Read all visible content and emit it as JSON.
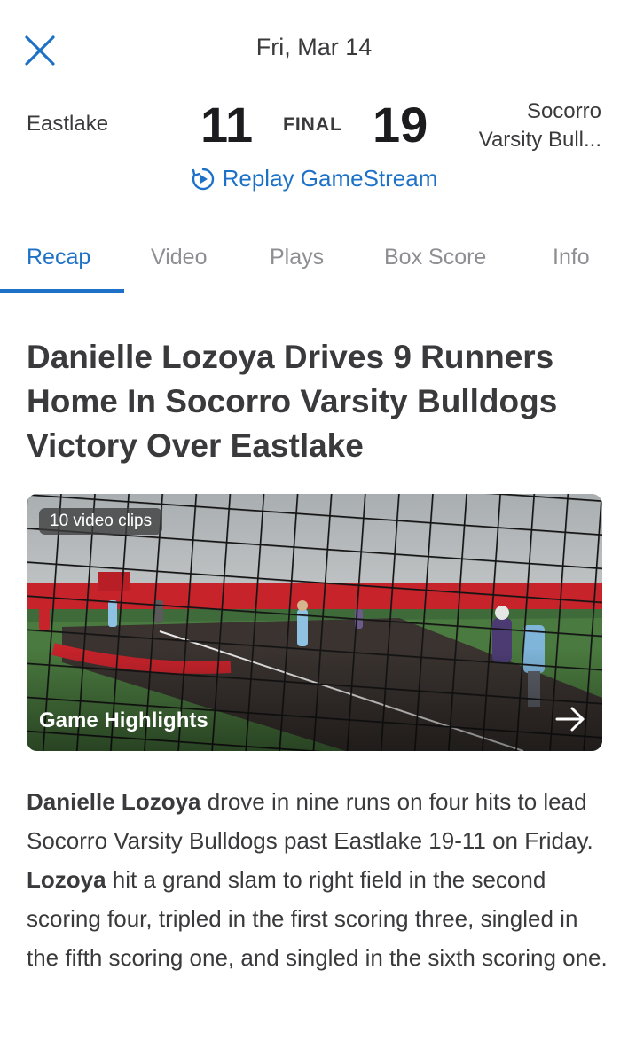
{
  "header": {
    "date": "Fri, Mar 14",
    "close_icon": "close-icon"
  },
  "score": {
    "home_team": "Eastlake",
    "home_score": "11",
    "status": "FINAL",
    "away_score": "19",
    "away_team_line1": "Socorro",
    "away_team_line2": "Varsity Bull..."
  },
  "replay": {
    "label": "Replay GameStream",
    "icon": "replay-icon"
  },
  "tabs": [
    {
      "label": "Recap",
      "active": true
    },
    {
      "label": "Video",
      "active": false
    },
    {
      "label": "Plays",
      "active": false
    },
    {
      "label": "Box Score",
      "active": false
    },
    {
      "label": "Info",
      "active": false
    }
  ],
  "colors": {
    "accent": "#1d72c8",
    "text": "#3a3a3c",
    "muted": "#8e8e93"
  },
  "article": {
    "headline": "Danielle Lozoya Drives 9 Runners Home In Socorro Varsity Bulldogs Victory Over Eastlake",
    "video": {
      "badge": "10 video clips",
      "title": "Game Highlights",
      "arrow_icon": "arrow-right-icon"
    },
    "body": {
      "player": "Danielle Lozoya",
      "part1": " drove in nine runs on four hits to lead Socorro Varsity Bulldogs past Eastlake 19-11 on Friday. ",
      "player_short": "Lozoya",
      "part2": " hit a grand slam to right field in the second scoring four, tripled in the first scoring three, singled in the fifth scoring one, and singled in the sixth scoring one."
    }
  }
}
